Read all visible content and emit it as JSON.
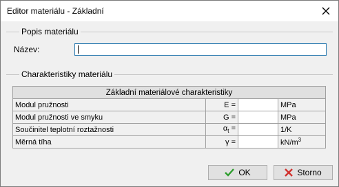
{
  "window": {
    "title": "Editor materiálu - Základní",
    "close_icon": "close-icon"
  },
  "group_description": {
    "label": "Popis materiálu",
    "name_label": "Název:",
    "name_value": ""
  },
  "group_characteristics": {
    "label": "Charakteristiky materiálu",
    "table_header": "Základní materiálové charakteristiky",
    "rows": [
      {
        "name": "Modul pružnosti",
        "symbol": "E =",
        "value": "",
        "unit": "MPa"
      },
      {
        "name": "Modul pružnosti ve smyku",
        "symbol": "G =",
        "value": "",
        "unit": "MPa"
      },
      {
        "name": "Součinitel teplotní roztažnosti",
        "symbol": "αt =",
        "value": "",
        "unit": "1/K"
      },
      {
        "name": "Měrná tíha",
        "symbol": "γ =",
        "value": "",
        "unit": "kN/m3"
      }
    ]
  },
  "buttons": {
    "ok_label": "OK",
    "ok_icon": "check-icon",
    "ok_icon_color": "#2e9e2e",
    "cancel_label": "Storno",
    "cancel_icon": "cross-icon",
    "cancel_icon_color": "#d0312d"
  }
}
